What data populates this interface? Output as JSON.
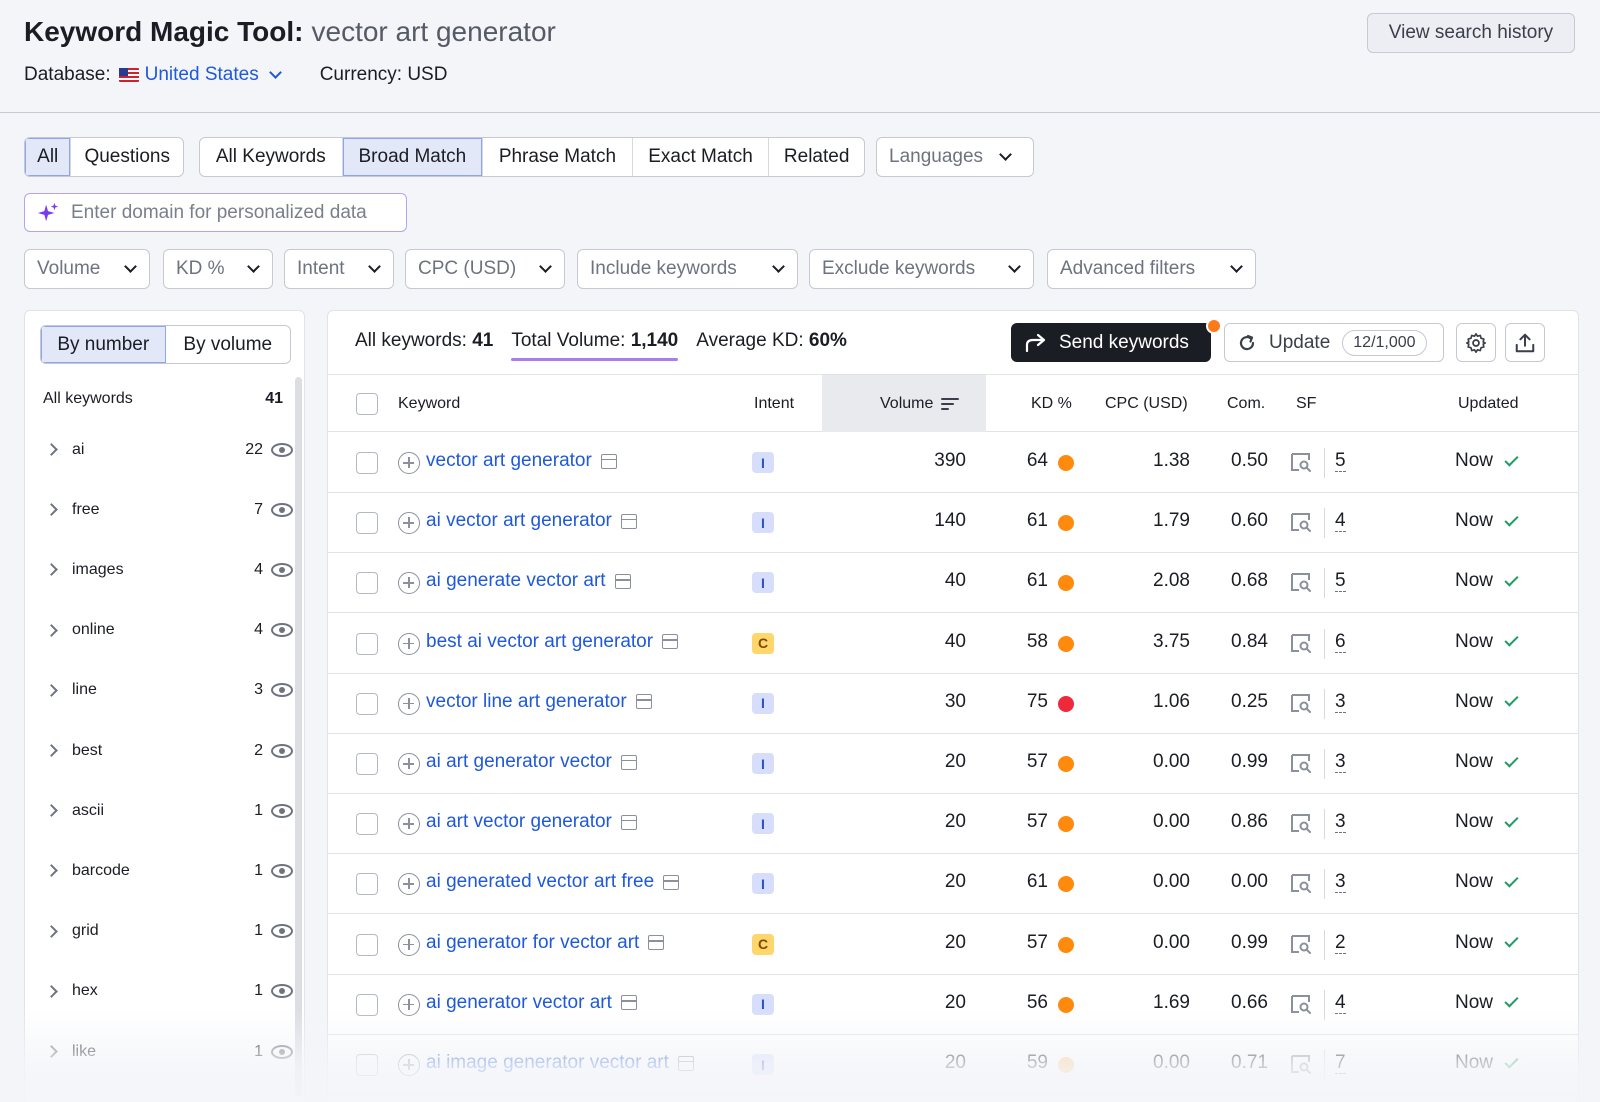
{
  "header": {
    "title": "Keyword Magic Tool:",
    "query": "vector art generator",
    "database_label": "Database:",
    "database_value": "United States",
    "currency": "Currency: USD",
    "history_button": "View search history"
  },
  "tabs_type": [
    "All",
    "Questions"
  ],
  "tabs_match": [
    "All Keywords",
    "Broad Match",
    "Phrase Match",
    "Exact Match",
    "Related"
  ],
  "languages": "Languages",
  "domain_input": {
    "placeholder": "Enter domain for personalized data"
  },
  "filters": [
    "Volume",
    "KD %",
    "Intent",
    "CPC (USD)",
    "Include keywords",
    "Exclude keywords",
    "Advanced filters"
  ],
  "sidebar": {
    "toggle": [
      "By number",
      "By volume"
    ],
    "all_label": "All keywords",
    "all_count": "41",
    "groups": [
      {
        "label": "ai",
        "count": "22"
      },
      {
        "label": "free",
        "count": "7"
      },
      {
        "label": "images",
        "count": "4"
      },
      {
        "label": "online",
        "count": "4"
      },
      {
        "label": "line",
        "count": "3"
      },
      {
        "label": "best",
        "count": "2"
      },
      {
        "label": "ascii",
        "count": "1"
      },
      {
        "label": "barcode",
        "count": "1"
      },
      {
        "label": "grid",
        "count": "1"
      },
      {
        "label": "hex",
        "count": "1"
      },
      {
        "label": "like",
        "count": "1"
      }
    ]
  },
  "summary": {
    "all_label": "All keywords:",
    "all_value": "41",
    "volume_label": "Total Volume:",
    "volume_value": "1,140",
    "kd_label": "Average KD:",
    "kd_value": "60%"
  },
  "actions": {
    "send": "Send keywords",
    "update": "Update",
    "update_count": "12/1,000"
  },
  "table": {
    "headers": [
      "Keyword",
      "Intent",
      "Volume",
      "KD %",
      "CPC (USD)",
      "Com.",
      "SF",
      "Updated"
    ],
    "rows": [
      {
        "keyword": "vector art generator",
        "intent": "I",
        "volume": "390",
        "kd": "64",
        "kd_color": "#ff8a0d",
        "cpc": "1.38",
        "com": "0.50",
        "sf": "5",
        "updated": "Now"
      },
      {
        "keyword": "ai vector art generator",
        "intent": "I",
        "volume": "140",
        "kd": "61",
        "kd_color": "#ff8a0d",
        "cpc": "1.79",
        "com": "0.60",
        "sf": "4",
        "updated": "Now"
      },
      {
        "keyword": "ai generate vector art",
        "intent": "I",
        "volume": "40",
        "kd": "61",
        "kd_color": "#ff8a0d",
        "cpc": "2.08",
        "com": "0.68",
        "sf": "5",
        "updated": "Now"
      },
      {
        "keyword": "best ai vector art generator",
        "intent": "C",
        "volume": "40",
        "kd": "58",
        "kd_color": "#ff8a0d",
        "cpc": "3.75",
        "com": "0.84",
        "sf": "6",
        "updated": "Now"
      },
      {
        "keyword": "vector line art generator",
        "intent": "I",
        "volume": "30",
        "kd": "75",
        "kd_color": "#f0283c",
        "cpc": "1.06",
        "com": "0.25",
        "sf": "3",
        "updated": "Now"
      },
      {
        "keyword": "ai art generator vector",
        "intent": "I",
        "volume": "20",
        "kd": "57",
        "kd_color": "#ff8a0d",
        "cpc": "0.00",
        "com": "0.99",
        "sf": "3",
        "updated": "Now"
      },
      {
        "keyword": "ai art vector generator",
        "intent": "I",
        "volume": "20",
        "kd": "57",
        "kd_color": "#ff8a0d",
        "cpc": "0.00",
        "com": "0.86",
        "sf": "3",
        "updated": "Now"
      },
      {
        "keyword": "ai generated vector art free",
        "intent": "I",
        "volume": "20",
        "kd": "61",
        "kd_color": "#ff8a0d",
        "cpc": "0.00",
        "com": "0.00",
        "sf": "3",
        "updated": "Now"
      },
      {
        "keyword": "ai generator for vector art",
        "intent": "C",
        "volume": "20",
        "kd": "57",
        "kd_color": "#ff8a0d",
        "cpc": "0.00",
        "com": "0.99",
        "sf": "2",
        "updated": "Now"
      },
      {
        "keyword": "ai generator vector art",
        "intent": "I",
        "volume": "20",
        "kd": "56",
        "kd_color": "#ff8a0d",
        "cpc": "1.69",
        "com": "0.66",
        "sf": "4",
        "updated": "Now"
      },
      {
        "keyword": "ai image generator vector art",
        "intent": "I",
        "volume": "20",
        "kd": "59",
        "kd_color": "#ffc27a",
        "cpc": "0.00",
        "com": "0.71",
        "sf": "7",
        "updated": "Now"
      }
    ]
  },
  "colors": {
    "link": "#1f59d9",
    "accent_underline": "#a77df0",
    "send_button": "#1b1d24",
    "check": "#1f9d62"
  }
}
